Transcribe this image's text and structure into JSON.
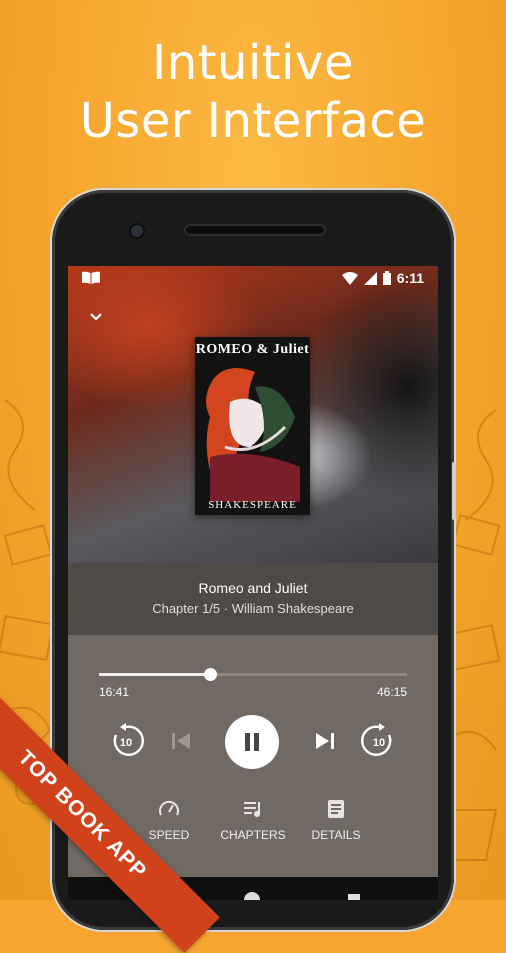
{
  "headline": {
    "line1": "Intuitive",
    "line2": "User Interface"
  },
  "status_bar": {
    "time": "6:11"
  },
  "book": {
    "cover_title": "ROMEO & Juliet",
    "cover_author": "SHAKESPEARE",
    "title": "Romeo and Juliet",
    "subtitle": "Chapter 1/5 · William Shakespeare"
  },
  "player": {
    "elapsed": "16:41",
    "total": "46:15",
    "progress_fraction": 0.36,
    "rewind_seconds": "10",
    "forward_seconds": "10"
  },
  "actions": [
    {
      "label": "SPEED",
      "icon": "speedometer-icon"
    },
    {
      "label": "CHAPTERS",
      "icon": "playlist-icon"
    },
    {
      "label": "DETAILS",
      "icon": "document-icon"
    }
  ],
  "ribbon": {
    "text": "TOP BOOK APP"
  },
  "colors": {
    "background": "#f6a630",
    "ribbon": "#d0421b",
    "player_panel": "#716964"
  }
}
